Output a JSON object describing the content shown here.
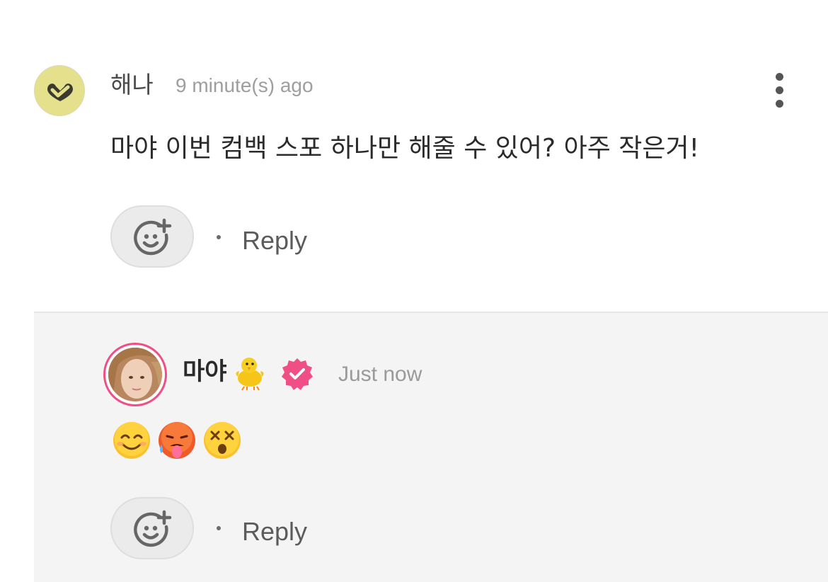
{
  "comment": {
    "username": "해나",
    "time": "9 minute(s) ago",
    "text": "마야 이번 컴백 스포 하나만 해줄 수 있어? 아주 작은거!",
    "avatar_icon": "heart-check-icon",
    "reply_label": "Reply",
    "react_icon": "add-reaction-icon",
    "more_icon": "more-vertical-icon"
  },
  "reply": {
    "username": "마야",
    "username_emoji": "chick-icon",
    "verified_icon": "verified-badge-icon",
    "time": "Just now",
    "emojis": [
      "smiling-face-icon",
      "hot-face-icon",
      "dizzy-face-icon"
    ],
    "reply_label": "Reply",
    "react_icon": "add-reaction-icon"
  },
  "colors": {
    "accent_pink": "#ef4f85",
    "avatar_yellow": "#e4e08c",
    "reply_bg": "#f4f4f4"
  }
}
